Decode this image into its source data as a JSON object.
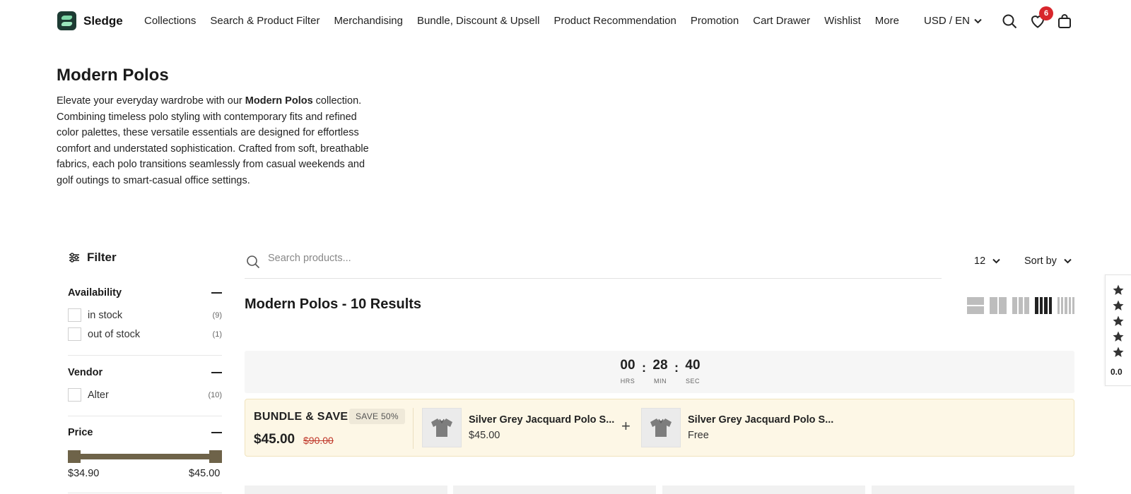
{
  "brand": {
    "name": "Sledge"
  },
  "nav": {
    "items": [
      "Collections",
      "Search & Product Filter",
      "Merchandising",
      "Bundle, Discount & Upsell",
      "Product Recommendation",
      "Promotion",
      "Cart Drawer",
      "Wishlist",
      "More"
    ],
    "currency": "USD / EN",
    "wishlist_count": "6"
  },
  "collection": {
    "title": "Modern Polos",
    "intro_before": "Elevate your everyday wardrobe with our ",
    "intro_bold": "Modern Polos",
    "intro_after": " collection. Combining timeless polo styling with contemporary fits and refined color palettes, these versatile essentials are designed for effortless comfort and understated sophistication. Crafted from soft, breathable fabrics, each polo transitions seamlessly from casual weekends and golf outings to smart-casual office settings."
  },
  "filter": {
    "label": "Filter",
    "availability": {
      "title": "Availability",
      "options": [
        {
          "label": "in stock",
          "count": "(9)"
        },
        {
          "label": "out of stock",
          "count": "(1)"
        }
      ]
    },
    "vendor": {
      "title": "Vendor",
      "options": [
        {
          "label": "Alter",
          "count": "(10)"
        }
      ]
    },
    "price": {
      "title": "Price",
      "min": "$34.90",
      "max": "$45.00",
      "min_fraction": 0,
      "max_fraction": 1
    }
  },
  "toolbar": {
    "search_placeholder": "Search products...",
    "per_page": "12",
    "sort_label": "Sort by",
    "results_title": "Modern Polos - 10 Results"
  },
  "countdown": {
    "hours": "00",
    "hours_label": "HRS",
    "minutes": "28",
    "minutes_label": "MIN",
    "seconds": "40",
    "seconds_label": "SEC"
  },
  "bundle": {
    "title": "BUNDLE & SAVE",
    "save_tag": "SAVE 50%",
    "price": "$45.00",
    "old_price": "$90.00",
    "items": [
      {
        "name": "Silver Grey Jacquard Polo S...",
        "price": "$45.00"
      },
      {
        "name": "Silver Grey Jacquard Polo S...",
        "price": "Free"
      }
    ]
  },
  "reviews": {
    "score": "0.0"
  },
  "colors": {
    "accent": "#6e6349",
    "badge": "#d8262c",
    "bundle_bg": "#fdf7e6"
  }
}
